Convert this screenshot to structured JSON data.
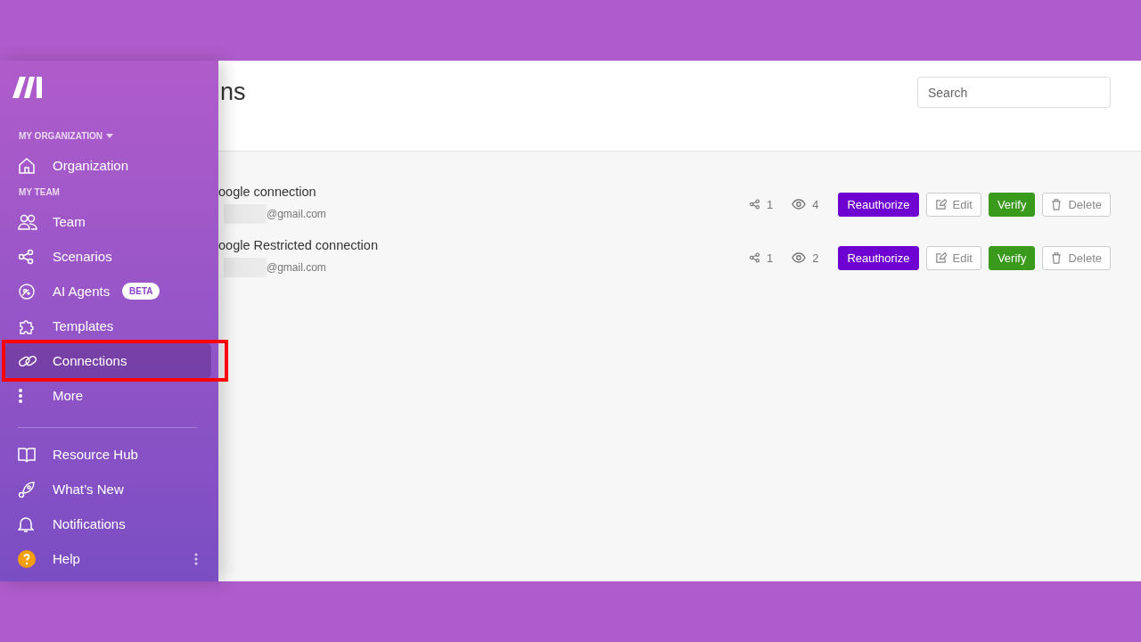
{
  "sidebar": {
    "items": [
      {
        "kind": "section",
        "label": "MY ORGANIZATION",
        "dropdown": true
      },
      {
        "kind": "item",
        "label": "Organization",
        "selected": false
      },
      {
        "kind": "section",
        "label": "MY TEAM"
      },
      {
        "kind": "item",
        "label": "Team",
        "selected": false
      },
      {
        "kind": "item",
        "label": "Scenarios",
        "selected": false
      },
      {
        "kind": "item",
        "label": "AI Agents",
        "selected": false,
        "badge": "BETA"
      },
      {
        "kind": "item",
        "label": "Templates",
        "selected": false
      },
      {
        "kind": "item",
        "label": "Connections",
        "selected": true,
        "highlighted": true
      },
      {
        "kind": "item",
        "label": "More",
        "selected": false
      },
      {
        "kind": "divider"
      },
      {
        "kind": "item",
        "label": "Resource Hub",
        "selected": false
      },
      {
        "kind": "item",
        "label": "What’s New",
        "selected": false
      },
      {
        "kind": "item",
        "label": "Notifications",
        "selected": false
      },
      {
        "kind": "item",
        "label": "Help",
        "selected": false,
        "menu": true
      }
    ]
  },
  "header": {
    "title": "ns",
    "search": {
      "placeholder": "Search"
    }
  },
  "connections": [
    {
      "name": "oogle connection",
      "account": "@gmail.com",
      "scenarios": "1",
      "views": "4",
      "buttons": [
        {
          "kind": "primary",
          "label": "Reauthorize"
        },
        {
          "kind": "outline",
          "label": "Edit"
        },
        {
          "kind": "success",
          "label": "Verify"
        },
        {
          "kind": "outline",
          "label": "Delete"
        }
      ]
    },
    {
      "name": "oogle Restricted connection",
      "account": "@gmail.com",
      "scenarios": "1",
      "views": "2",
      "buttons": [
        {
          "kind": "primary",
          "label": "Reauthorize"
        },
        {
          "kind": "outline",
          "label": "Edit"
        },
        {
          "kind": "success",
          "label": "Verify"
        },
        {
          "kind": "outline",
          "label": "Delete"
        }
      ]
    }
  ]
}
